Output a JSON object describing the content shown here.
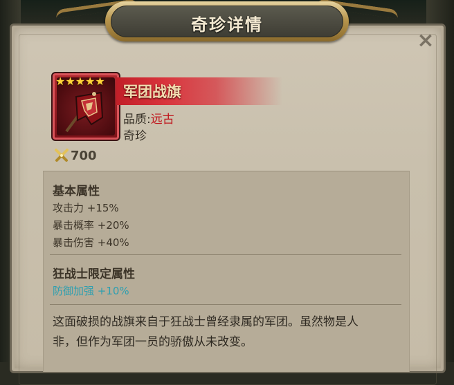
{
  "dialog": {
    "title": "奇珍详情",
    "close_icon": "×"
  },
  "item": {
    "stars": [
      "★",
      "★",
      "★",
      "★",
      "★"
    ],
    "star_count": 5,
    "name": "军团战旗",
    "quality_label": "品质",
    "quality_separator": ":",
    "quality_value": "远古",
    "category": "奇珍",
    "price": "700",
    "icon": "war-banner-icon",
    "price_icon": "crossed-swords-icon"
  },
  "basic_attributes": {
    "title": "基本属性",
    "lines": [
      "攻击力 +15%",
      "暴击概率 +20%",
      "暴击伤害 +40%"
    ]
  },
  "class_attributes": {
    "title": "狂战士限定属性",
    "lines": [
      "防御加强 +10%"
    ]
  },
  "description": {
    "line1": "这面破损的战旗来自于狂战士曾经隶属的军团。虽然物是人",
    "line2": "非，但作为军团一员的骄傲从未改变。"
  },
  "colors": {
    "quality_red": "#c0151c",
    "class_attr_cyan": "#2e9fb0",
    "star_gold": "#ffd43a"
  }
}
